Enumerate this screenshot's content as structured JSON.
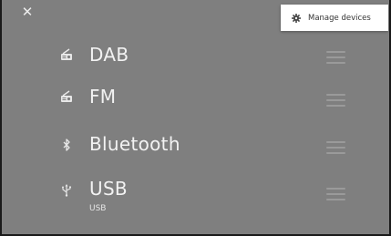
{
  "header": {
    "close_icon": "close-icon"
  },
  "menu": {
    "items": [
      {
        "label": "Manage devices",
        "icon": "gear-icon"
      }
    ]
  },
  "sources": [
    {
      "label": "DAB",
      "icon": "radio-icon",
      "sublabel": ""
    },
    {
      "label": "FM",
      "icon": "radio-icon",
      "sublabel": ""
    },
    {
      "label": "Bluetooth",
      "icon": "bluetooth-icon",
      "sublabel": ""
    },
    {
      "label": "USB",
      "icon": "usb-icon",
      "sublabel": "USB"
    }
  ],
  "colors": {
    "background": "#7f7f7f",
    "text": "#f2f2f2",
    "handle": "#9a9a9a"
  }
}
